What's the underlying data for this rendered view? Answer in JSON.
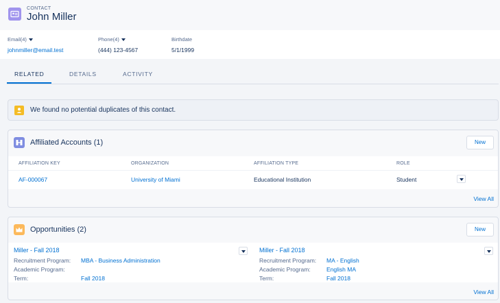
{
  "header": {
    "object_label": "CONTACT",
    "record_name": "John Miller"
  },
  "fields": {
    "email": {
      "label": "Email(4)",
      "value": "johnmiller@email.test"
    },
    "phone": {
      "label": "Phone(4)",
      "value": "(444) 123-4567"
    },
    "birthdate": {
      "label": "Birthdate",
      "value": "5/1/1999"
    }
  },
  "tabs": [
    {
      "label": "RELATED",
      "active": true
    },
    {
      "label": "DETAILS",
      "active": false
    },
    {
      "label": "ACTIVITY",
      "active": false
    }
  ],
  "duplicates_alert": {
    "text": "We found no potential duplicates of this contact."
  },
  "affiliated_accounts": {
    "title": "Affiliated Accounts (1)",
    "new_label": "New",
    "columns": [
      "AFFILIATION KEY",
      "ORGANIZATION",
      "AFFILIATION TYPE",
      "ROLE"
    ],
    "rows": [
      {
        "key": "AF-000067",
        "organization": "University of Miami",
        "type": "Educational Institution",
        "role": "Student"
      }
    ],
    "view_all": "View All"
  },
  "opportunities": {
    "title": "Opportunities (2)",
    "new_label": "New",
    "items": [
      {
        "name": "Miller - Fall 2018",
        "recruitment_label": "Recruitment Program:",
        "recruitment_value": "MBA - Business Administration",
        "academic_label": "Academic Program:",
        "academic_value": "",
        "term_label": "Term:",
        "term_value": "Fall 2018"
      },
      {
        "name": "Miller - Fall 2018",
        "recruitment_label": "Recruitment Program:",
        "recruitment_value": "MA - English",
        "academic_label": "Academic Program:",
        "academic_value": "English MA",
        "term_label": "Term:",
        "term_value": "Fall 2018"
      }
    ],
    "view_all": "View All"
  },
  "colors": {
    "link": "#0070d2",
    "text": "#16325c",
    "contact_icon": "#a094ed",
    "affiliation_icon": "#7f8de1",
    "opportunity_icon": "#fcb95b",
    "alert_icon": "#f4bc25"
  },
  "icons": {
    "contact": "contact-card-icon",
    "alert": "alert-icon",
    "affiliations": "affiliations-icon",
    "opportunities": "crown-icon"
  }
}
